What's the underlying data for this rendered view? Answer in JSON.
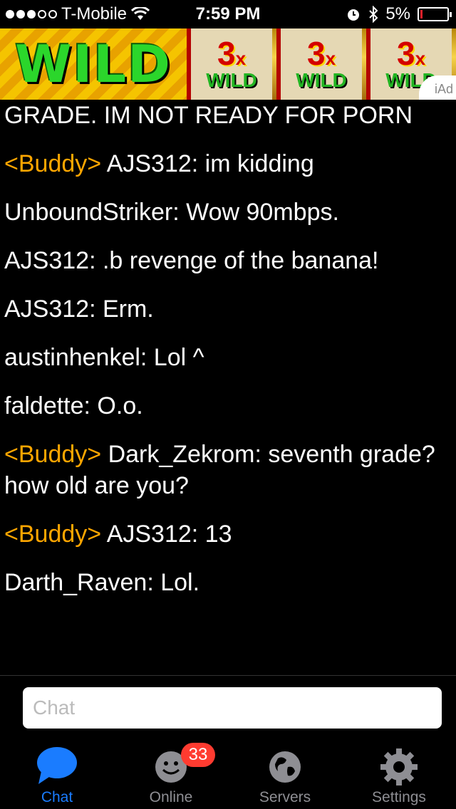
{
  "status_bar": {
    "carrier": "T-Mobile",
    "time": "7:59 PM",
    "battery": "5%",
    "signal_bars_filled": 3,
    "signal_bars_total": 5
  },
  "ad": {
    "wild_text": "WILD",
    "tiles": [
      {
        "three": "3",
        "x": "x",
        "wild": "WILD"
      },
      {
        "three": "3",
        "x": "x",
        "wild": "WILD"
      },
      {
        "three": "3",
        "x": "x",
        "wild": "WILD"
      }
    ],
    "iad": "iAd"
  },
  "chat": {
    "messages": [
      {
        "prefix": "",
        "text": "GRADE. IM NOT READY FOR PORN"
      },
      {
        "prefix": "<Buddy>",
        "text": "AJS312: im kidding"
      },
      {
        "prefix": "",
        "text": "UnboundStriker: Wow 90mbps."
      },
      {
        "prefix": "",
        "text": "AJS312: .b revenge of the banana!"
      },
      {
        "prefix": "",
        "text": "AJS312: Erm."
      },
      {
        "prefix": "",
        "text": "austinhenkel: Lol ^"
      },
      {
        "prefix": "",
        "text": "faldette: O.o."
      },
      {
        "prefix": "<Buddy>",
        "text": "Dark_Zekrom: seventh grade? how old are you?"
      },
      {
        "prefix": "<Buddy>",
        "text": "AJS312: 13"
      },
      {
        "prefix": "",
        "text": "Darth_Raven: Lol."
      }
    ],
    "buddy_color": "#ffa600"
  },
  "input": {
    "placeholder": "Chat",
    "value": ""
  },
  "tabs": [
    {
      "label": "Chat",
      "icon": "chat-bubble-icon",
      "active": true
    },
    {
      "label": "Online",
      "icon": "smiley-icon",
      "badge": "33",
      "active": false
    },
    {
      "label": "Servers",
      "icon": "globe-icon",
      "active": false
    },
    {
      "label": "Settings",
      "icon": "gear-icon",
      "active": false
    }
  ],
  "colors": {
    "active_tab": "#1a7cff",
    "inactive_tab": "#8e8e93",
    "badge": "#ff3b30"
  }
}
